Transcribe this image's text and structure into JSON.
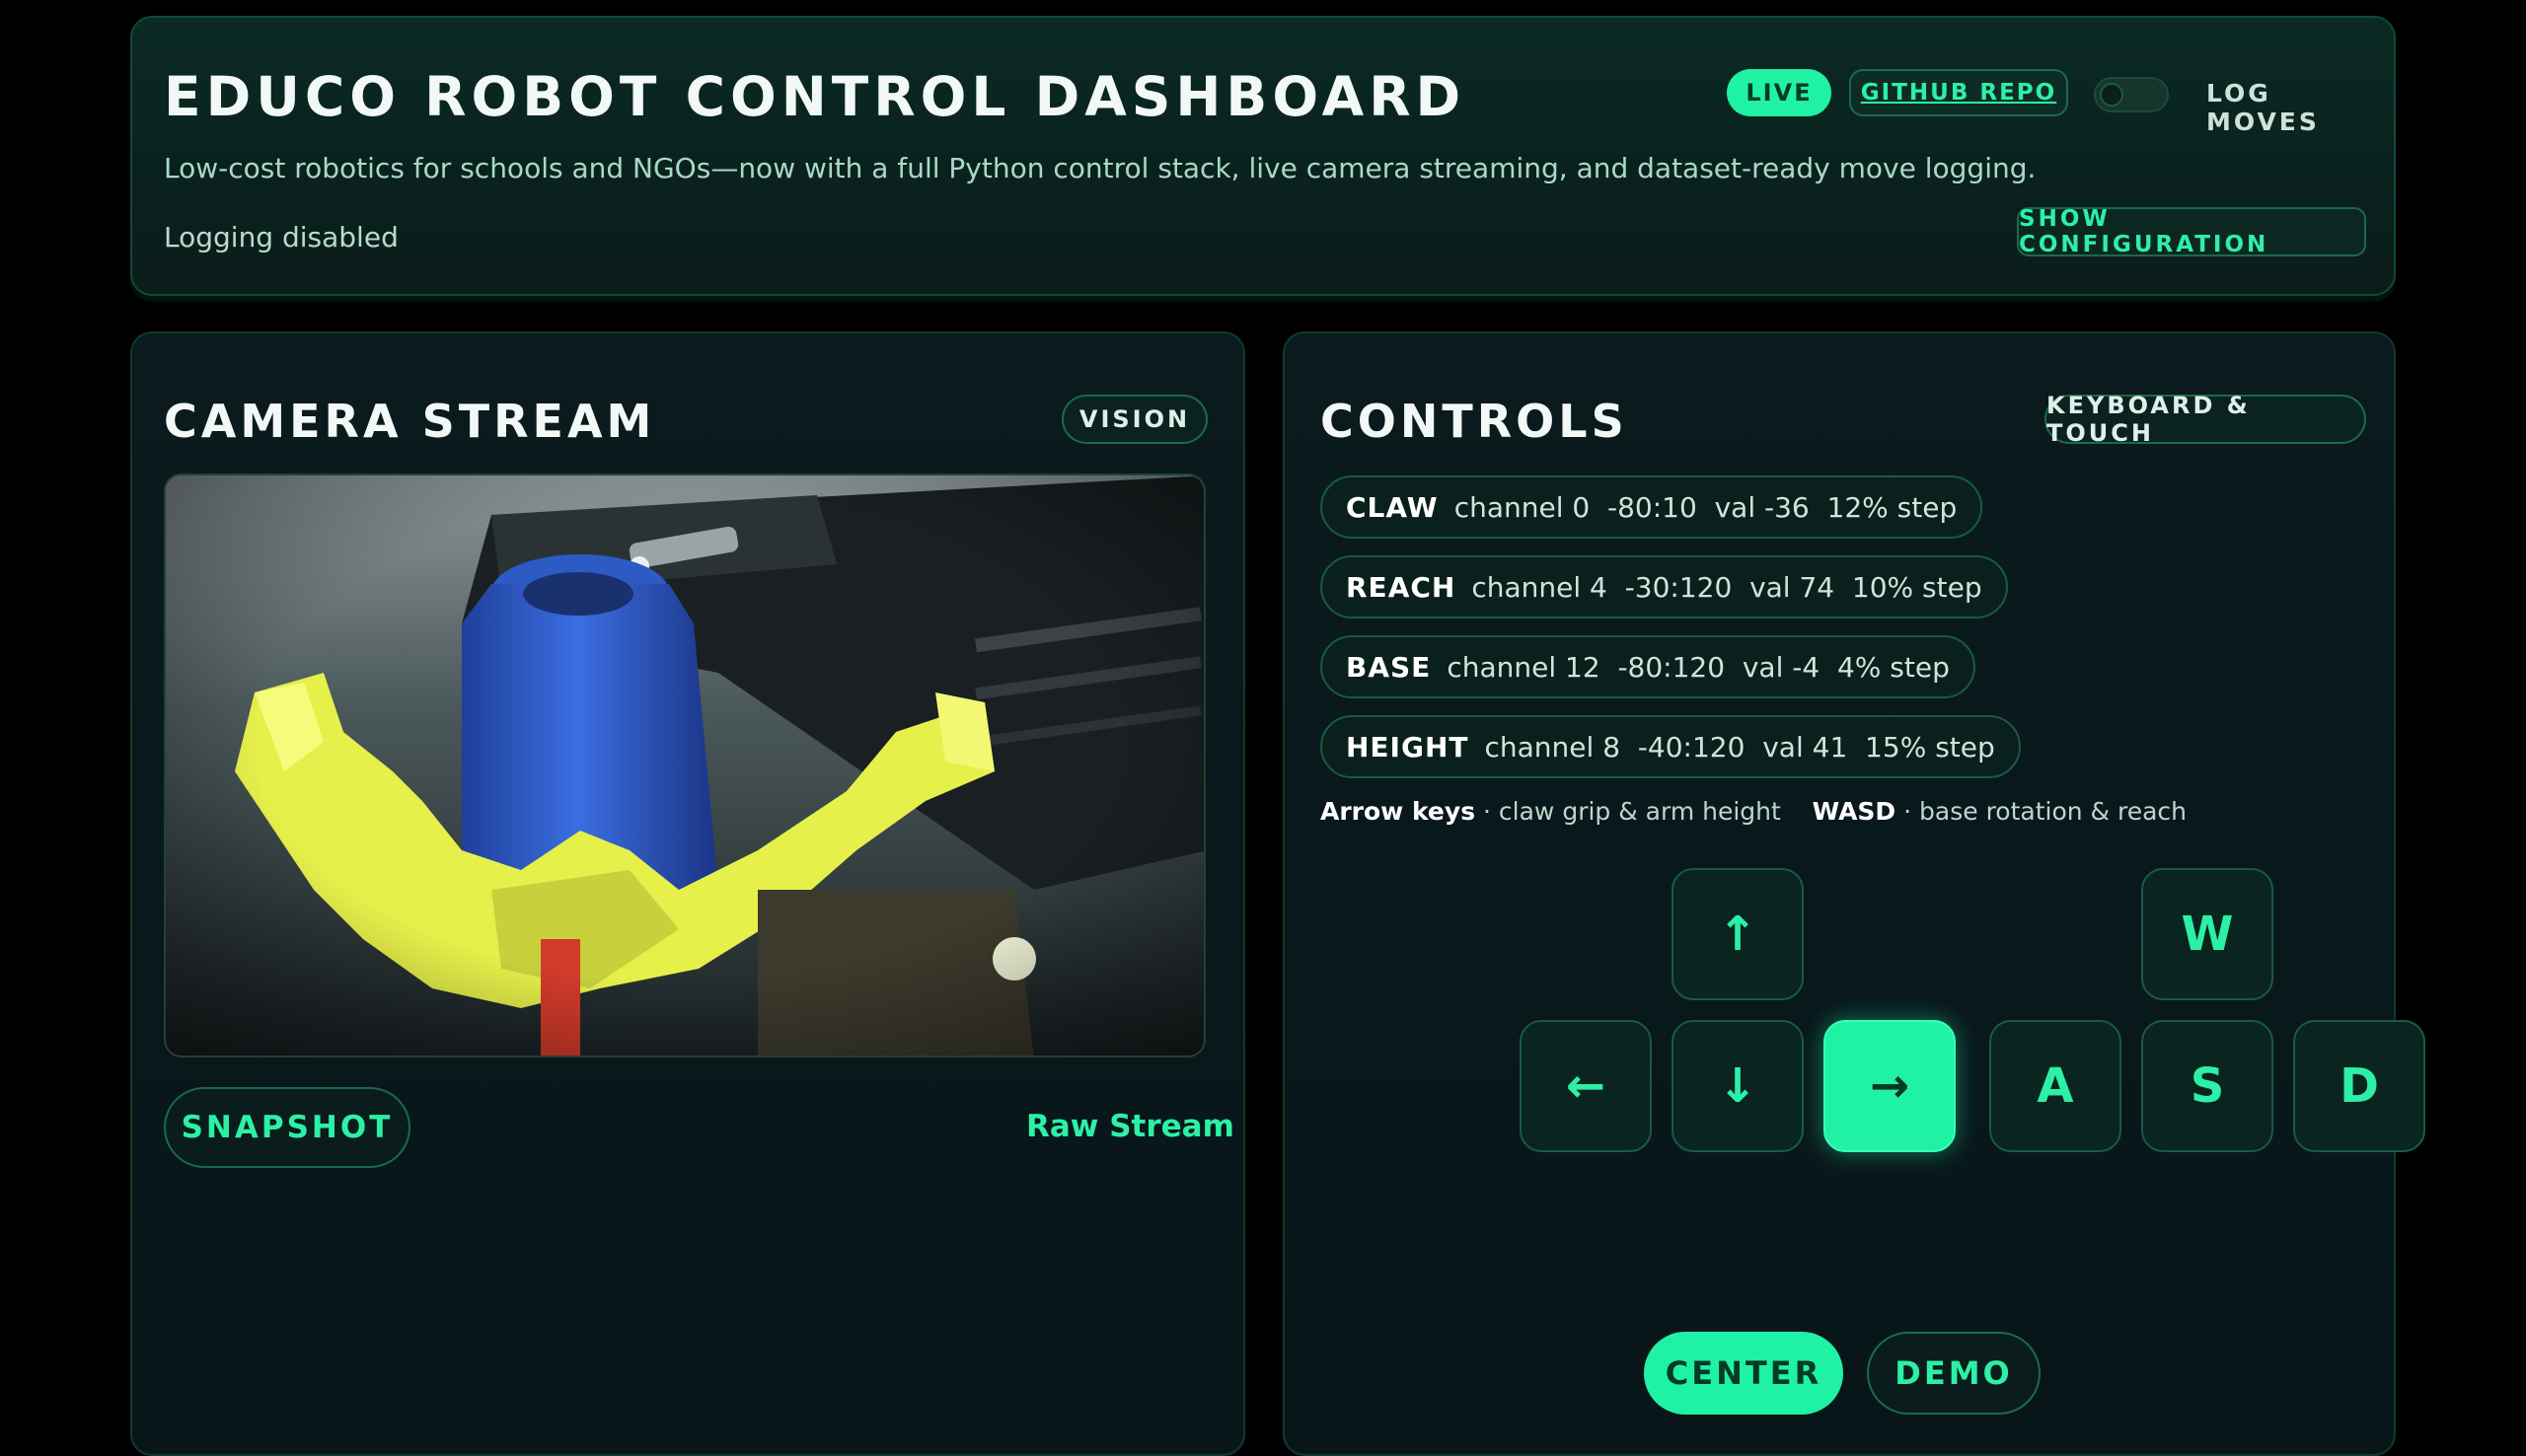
{
  "header": {
    "title": "EDUCO ROBOT CONTROL DASHBOARD",
    "subtitle": "Low-cost robotics for schools and NGOs—now with a full Python control stack, live camera streaming, and dataset-ready move logging.",
    "logging_status": "Logging disabled",
    "live_label": "LIVE",
    "github_label": "GITHUB REPO",
    "log_moves_label": "LOG MOVES",
    "log_moves_enabled": false,
    "config_label": "SHOW CONFIGURATION"
  },
  "camera": {
    "title": "CAMERA STREAM",
    "tag": "VISION",
    "snapshot_label": "SNAPSHOT",
    "mode_label": "Raw Stream"
  },
  "controls": {
    "title": "CONTROLS",
    "tag": "KEYBOARD & TOUCH",
    "joints": [
      {
        "name": "CLAW",
        "details": "channel 0  -80:10  val -36  12% step"
      },
      {
        "name": "REACH",
        "details": "channel 4  -30:120  val 74  10% step"
      },
      {
        "name": "BASE",
        "details": "channel 12  -80:120  val -4  4% step"
      },
      {
        "name": "HEIGHT",
        "details": "channel 8  -40:120  val 41  15% step"
      }
    ],
    "hint": {
      "arrows_key": "Arrow keys",
      "arrows_desc": " · claw grip & arm height",
      "wasd_key": "WASD",
      "wasd_desc": " · base rotation & reach"
    },
    "keys": {
      "up": "↑",
      "left": "←",
      "down": "↓",
      "right": "→",
      "w": "W",
      "a": "A",
      "s": "S",
      "d": "D"
    },
    "active_key": "right",
    "center_label": "CENTER",
    "demo_label": "DEMO"
  },
  "colors": {
    "accent": "#1ff2a5",
    "background": "#000000",
    "card": "#0a1a1d"
  }
}
